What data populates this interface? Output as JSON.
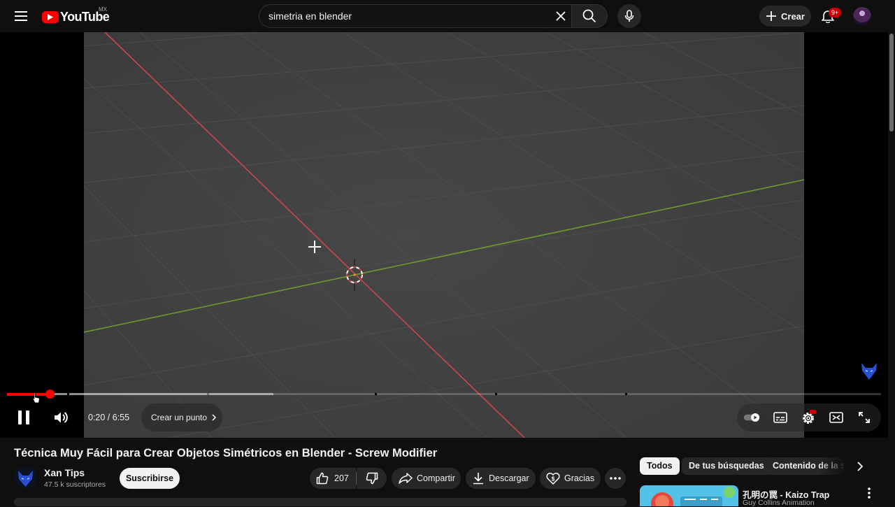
{
  "topbar": {
    "logo_text": "YouTube",
    "country_code": "MX",
    "search_value": "simetria en blender",
    "create_label": "Crear",
    "notification_count": "9+"
  },
  "player": {
    "time_display": "0:20 / 6:55",
    "chapter_label": "Crear un punto",
    "progress": {
      "current_seconds": 20,
      "duration_seconds": 415
    }
  },
  "video": {
    "title": "Técnica Muy Fácil para Crear Objetos Simétricos en Blender - Screw Modifier",
    "channel_name": "Xan Tips",
    "subscribers": "47.5 k suscriptores",
    "subscribe_label": "Suscribirse",
    "likes": "207",
    "share_label": "Compartir",
    "download_label": "Descargar",
    "thanks_label": "Gracias"
  },
  "sidebar": {
    "chips": [
      "Todos",
      "De tus búsquedas",
      "Contenido de la ser"
    ],
    "related": [
      {
        "title": "孔明の罠 - Kaizo Trap",
        "channel": "Guy Collins Animation"
      }
    ]
  },
  "colors": {
    "brand_red": "#ff0000",
    "progress_red": "#ff0000",
    "background": "#0f0f0f"
  }
}
